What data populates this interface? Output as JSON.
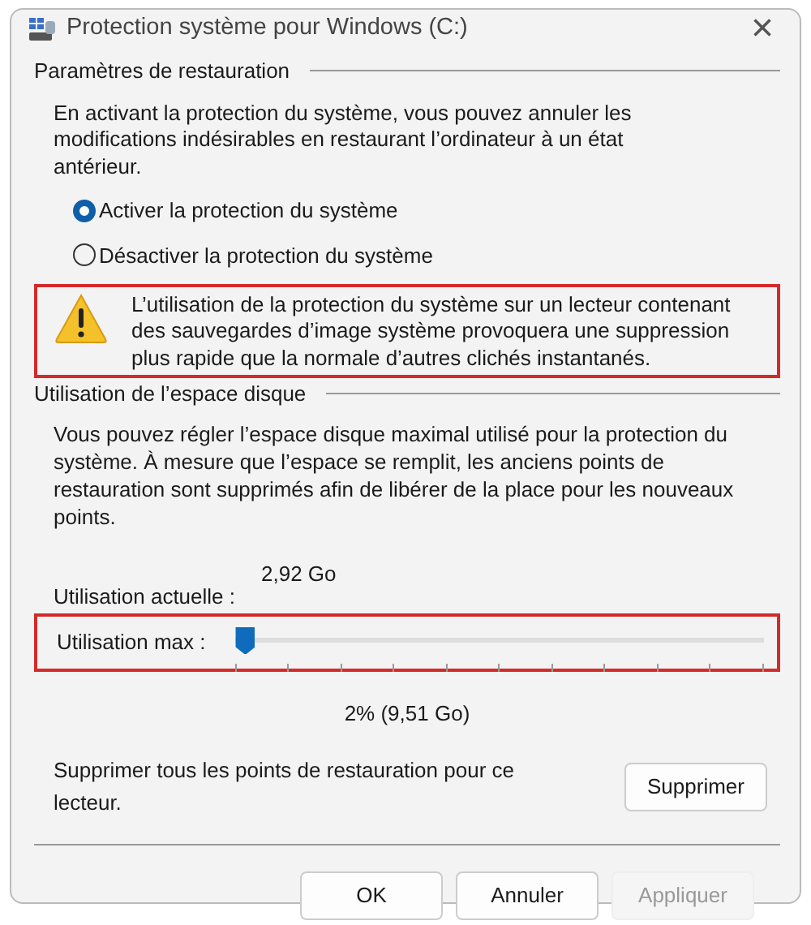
{
  "window": {
    "title": "Protection système pour Windows (C:)",
    "close": "×"
  },
  "restore_settings": {
    "heading": "Paramètres de restauration",
    "description": "En activant la protection du système, vous pouvez annuler les modifications indésirables en restaurant l’ordinateur à un état antérieur.",
    "options": [
      {
        "label": "Activer la protection du système",
        "selected": true
      },
      {
        "label": "Désactiver la protection du système",
        "selected": false
      }
    ]
  },
  "warning": {
    "text": "L’utilisation de la protection du système sur un lecteur contenant des sauvegardes d’image système provoquera une suppression plus rapide que la normale d’autres clichés instantanés.",
    "highlighted": true
  },
  "disk_usage": {
    "heading": "Utilisation de l’espace disque",
    "description": "Vous pouvez régler l’espace disque maximal utilisé pour la protection du système. À mesure que l’espace se remplit, les anciens points de restauration sont supprimés afin de libérer de la place pour les nouveaux points.",
    "current_label": "Utilisation actuelle :",
    "current_value": "2,92 Go",
    "max_label": "Utilisation max :",
    "max_slider": {
      "level": 0.02
    },
    "max_highlighted": true,
    "max_reading": "2% (9,51 Go)",
    "delete_text": "Supprimer tous les points de restauration pour ce lecteur.",
    "delete_button": "Supprimer"
  },
  "buttons": [
    {
      "label": "OK",
      "disabled": false
    },
    {
      "label": "Annuler",
      "disabled": false
    },
    {
      "label": "Appliquer",
      "disabled": true
    }
  ]
}
